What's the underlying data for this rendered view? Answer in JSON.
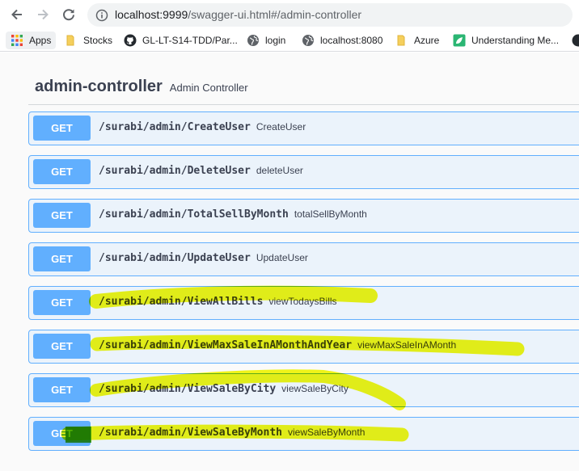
{
  "browser": {
    "url_host": "localhost:9999",
    "url_path": "/swagger-ui.html#/admin-controller",
    "bookmarks": [
      {
        "label": "Apps",
        "icon": "apps-grid-icon"
      },
      {
        "label": "Stocks",
        "icon": "folder-icon"
      },
      {
        "label": "GL-LT-S14-TDD/Par...",
        "icon": "github-icon"
      },
      {
        "label": "login",
        "icon": "globe-icon"
      },
      {
        "label": "localhost:8080",
        "icon": "globe-icon"
      },
      {
        "label": "Azure",
        "icon": "folder-icon"
      },
      {
        "label": "Understanding Me...",
        "icon": "leaf-icon"
      }
    ]
  },
  "controller": {
    "name": "admin-controller",
    "description": "Admin Controller"
  },
  "operations": [
    {
      "method": "GET",
      "path": "/surabi/admin/CreateUser",
      "summary": "CreateUser"
    },
    {
      "method": "GET",
      "path": "/surabi/admin/DeleteUser",
      "summary": "deleteUser"
    },
    {
      "method": "GET",
      "path": "/surabi/admin/TotalSellByMonth",
      "summary": "totalSellByMonth"
    },
    {
      "method": "GET",
      "path": "/surabi/admin/UpdateUser",
      "summary": "UpdateUser"
    },
    {
      "method": "GET",
      "path": "/surabi/admin/ViewAllBills",
      "summary": "viewTodaysBills"
    },
    {
      "method": "GET",
      "path": "/surabi/admin/ViewMaxSaleInAMonthAndYear",
      "summary": "viewMaxSaleInAMonth"
    },
    {
      "method": "GET",
      "path": "/surabi/admin/ViewSaleByCity",
      "summary": "viewSaleByCity"
    },
    {
      "method": "GET",
      "path": "/surabi/admin/ViewSaleByMonth",
      "summary": "viewSaleByMonth"
    }
  ],
  "colors": {
    "get_accent": "#61affe",
    "get_background": "#ebf3fb",
    "highlighter": "#f3f700",
    "highlighter_green": "#3aa800"
  }
}
